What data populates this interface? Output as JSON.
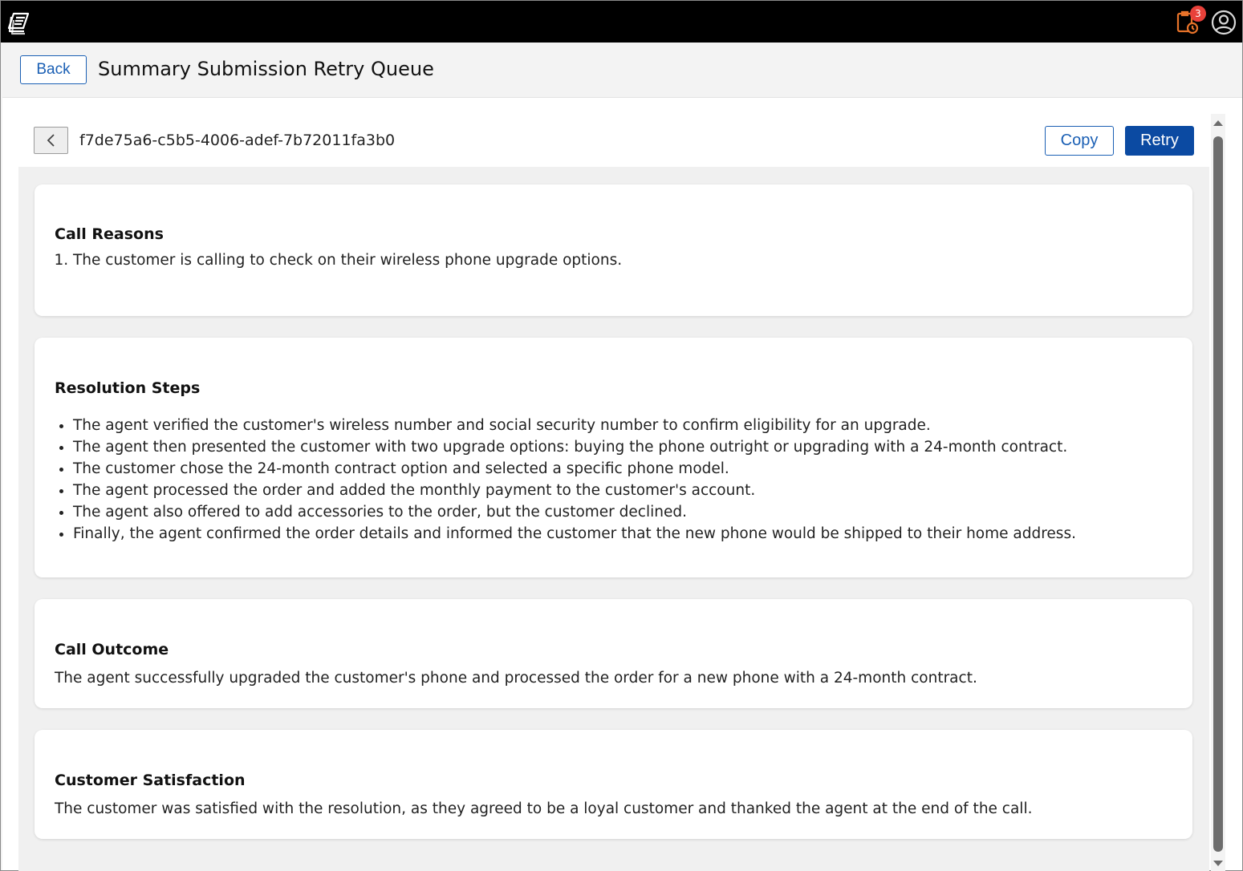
{
  "topbar": {
    "logo_icon": "app-logo-icon",
    "notification_icon": "clipboard-clock-icon",
    "notification_count": "3",
    "profile_icon": "user-circle-icon",
    "accent_color": "#e8732a",
    "badge_color": "#e8413a"
  },
  "header": {
    "back_label": "Back",
    "title": "Summary Submission Retry Queue"
  },
  "record": {
    "id": "f7de75a6-c5b5-4006-adef-7b72011fa3b0",
    "copy_label": "Copy",
    "retry_label": "Retry",
    "primary_color": "#0b4aa2"
  },
  "sections": {
    "call_reasons": {
      "title": "Call Reasons",
      "items": [
        "The customer is calling to check on their wireless phone upgrade options."
      ]
    },
    "resolution_steps": {
      "title": "Resolution Steps",
      "items": [
        "The agent verified the customer's wireless number and social security number to confirm eligibility for an upgrade.",
        "The agent then presented the customer with two upgrade options: buying the phone outright or upgrading with a 24-month contract.",
        "The customer chose the 24-month contract option and selected a specific phone model.",
        "The agent processed the order and added the monthly payment to the customer's account.",
        "The agent also offered to add accessories to the order, but the customer declined.",
        "Finally, the agent confirmed the order details and informed the customer that the new phone would be shipped to their home address."
      ]
    },
    "call_outcome": {
      "title": "Call Outcome",
      "text": "The agent successfully upgraded the customer's phone and processed the order for a new phone with a 24-month contract."
    },
    "customer_satisfaction": {
      "title": "Customer Satisfaction",
      "text": "The customer was satisfied with the resolution, as they agreed to be a loyal customer and thanked the agent at the end of the call."
    }
  }
}
